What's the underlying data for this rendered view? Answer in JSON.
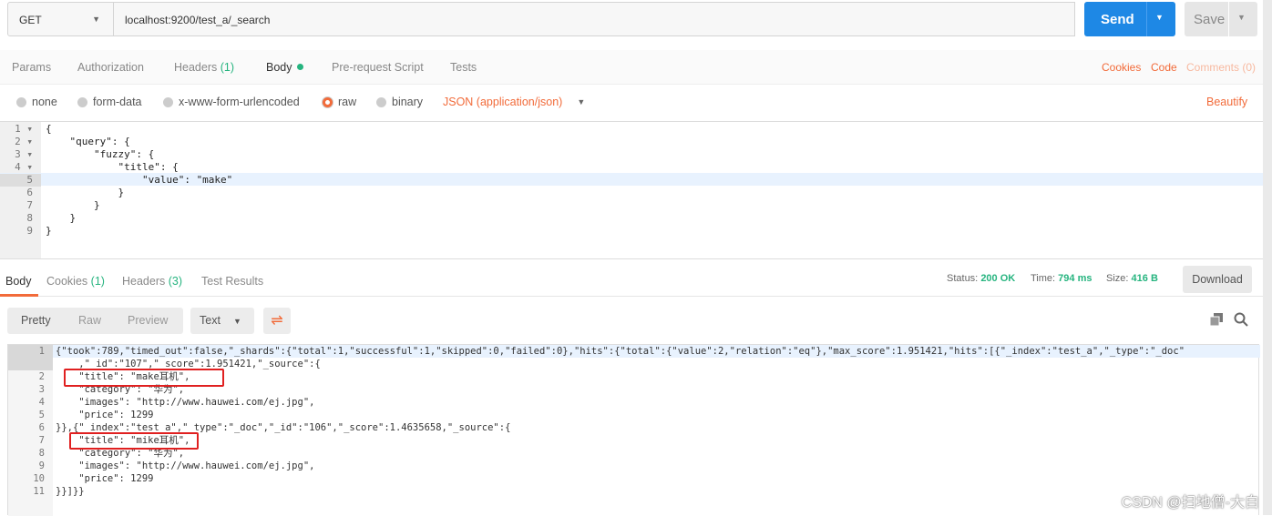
{
  "request": {
    "method": "GET",
    "url": "localhost:9200/test_a/_search",
    "send_label": "Send",
    "save_label": "Save"
  },
  "tabs": {
    "params": "Params",
    "authorization": "Authorization",
    "headers": "Headers",
    "headers_count": "(1)",
    "body": "Body",
    "prerequest": "Pre-request Script",
    "tests": "Tests",
    "cookies": "Cookies",
    "code": "Code",
    "comments": "Comments (0)"
  },
  "body_types": {
    "none": "none",
    "form_data": "form-data",
    "urlencoded": "x-www-form-urlencoded",
    "raw": "raw",
    "binary": "binary",
    "content_type": "JSON (application/json)",
    "beautify": "Beautify",
    "selected": "raw"
  },
  "request_body": [
    "{",
    "    \"query\": {",
    "        \"fuzzy\": {",
    "            \"title\": {",
    "                \"value\": \"make\"",
    "            }",
    "        }",
    "    }",
    "}"
  ],
  "response_tabs": {
    "body": "Body",
    "cookies": "Cookies",
    "cookies_count": "(1)",
    "headers": "Headers",
    "headers_count": "(3)",
    "test_results": "Test Results"
  },
  "status": {
    "status_label": "Status:",
    "status": "200 OK",
    "time_label": "Time:",
    "time": "794 ms",
    "size_label": "Size:",
    "size": "416 B",
    "download": "Download"
  },
  "response_toolbar": {
    "pretty": "Pretty",
    "raw": "Raw",
    "preview": "Preview",
    "format": "Text"
  },
  "response_body": [
    {
      "n": "1",
      "text": "{\"took\":789,\"timed_out\":false,\"_shards\":{\"total\":1,\"successful\":1,\"skipped\":0,\"failed\":0},\"hits\":{\"total\":{\"value\":2,\"relation\":\"eq\"},\"max_score\":1.951421,\"hits\":[{\"_index\":\"test_a\",\"_type\":\"_doc\""
    },
    {
      "n": "",
      "text": "    ,\"_id\":\"107\",\"_score\":1.951421,\"_source\":{"
    },
    {
      "n": "2",
      "text": "    \"title\": \"make耳机\","
    },
    {
      "n": "3",
      "text": "    \"category\": \"华为\","
    },
    {
      "n": "4",
      "text": "    \"images\": \"http://www.hauwei.com/ej.jpg\","
    },
    {
      "n": "5",
      "text": "    \"price\": 1299"
    },
    {
      "n": "6",
      "text": "}},{\"_index\":\"test_a\",\"_type\":\"_doc\",\"_id\":\"106\",\"_score\":1.4635658,\"_source\":{"
    },
    {
      "n": "7",
      "text": "    \"title\": \"mike耳机\","
    },
    {
      "n": "8",
      "text": "    \"category\": \"华为\","
    },
    {
      "n": "9",
      "text": "    \"images\": \"http://www.hauwei.com/ej.jpg\","
    },
    {
      "n": "10",
      "text": "    \"price\": 1299"
    },
    {
      "n": "11",
      "text": "}}]}}"
    }
  ],
  "watermark": "CSDN @扫地僧-大白",
  "colors": {
    "accent": "#f26b3a",
    "send": "#1e88e5",
    "success": "#26b47f",
    "highlight": "#e02020"
  }
}
